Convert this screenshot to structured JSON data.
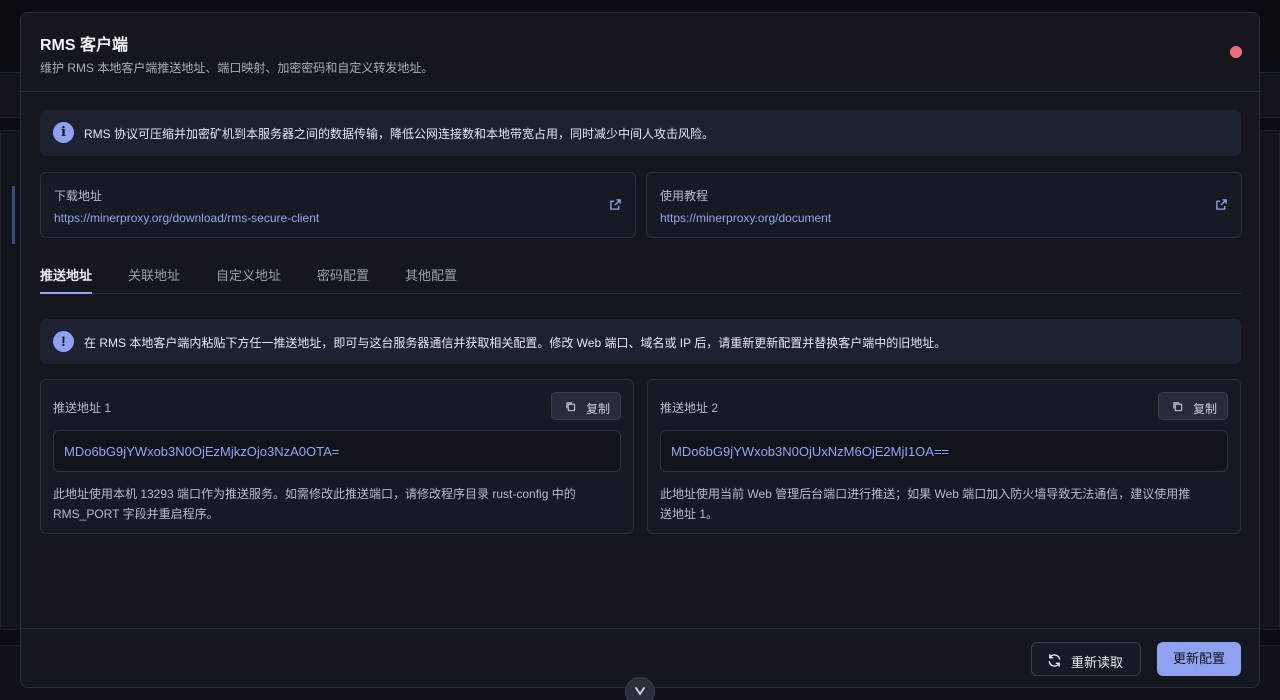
{
  "modal": {
    "title": "RMS 客户端",
    "subtitle": "维护 RMS 本地客户端推送地址、端口映射、加密密码和自定义转发地址。"
  },
  "info_banner": {
    "text": "RMS 协议可压缩并加密矿机到本服务器之间的数据传输，降低公网连接数和本地带宽占用，同时减少中间人攻击风险。"
  },
  "links": [
    {
      "label": "下载地址",
      "url": "https://minerproxy.org/download/rms-secure-client"
    },
    {
      "label": "使用教程",
      "url": "https://minerproxy.org/document"
    }
  ],
  "tabs": [
    "推送地址",
    "关联地址",
    "自定义地址",
    "密码配置",
    "其他配置"
  ],
  "active_tab": "推送地址",
  "warn_banner": {
    "text": "在 RMS 本地客户端内粘贴下方任一推送地址，即可与这台服务器通信并获取相关配置。修改 Web 端口、域名或 IP 后，请重新更新配置并替换客户端中的旧地址。"
  },
  "push_addresses": [
    {
      "label": "推送地址 1",
      "copy_label": "复制",
      "value": "MDo6bG9jYWxob3N0OjEzMjkzOjo3NzA0OTA=",
      "note": "此地址使用本机 13293 端口作为推送服务。如需修改此推送端口，请修改程序目录 rust-config 中的 RMS_PORT 字段并重启程序。"
    },
    {
      "label": "推送地址 2",
      "copy_label": "复制",
      "value": "MDo6bG9jYWxob3N0OjUxNzM6OjE2MjI1OA==",
      "note": "此地址使用当前 Web 管理后台端口进行推送；如果 Web 端口加入防火墙导致无法通信，建议使用推送地址 1。"
    }
  ],
  "footer": {
    "reload_label": "重新读取",
    "update_label": "更新配置"
  },
  "colors": {
    "accent": "#8fa1f0",
    "link": "#8fa7f5",
    "close": "#f06b7a"
  }
}
